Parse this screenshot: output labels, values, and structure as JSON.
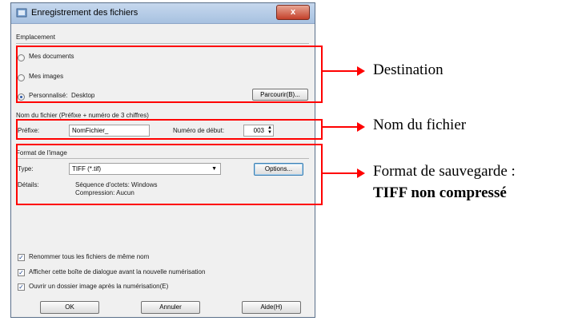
{
  "window": {
    "title": "Enregistrement des fichiers",
    "close_label": "x"
  },
  "emplacement": {
    "label": "Emplacement",
    "options": [
      {
        "label": "Mes documents",
        "checked": false
      },
      {
        "label": "Mes images",
        "checked": false
      },
      {
        "label": "Personnalisé:",
        "checked": true
      }
    ],
    "custom_value": "Desktop",
    "browse_label": "Parcourir(B)..."
  },
  "nom": {
    "label": "Nom du fichier (Préfixe + numéro de 3 chiffres)",
    "prefix_label": "Préfixe:",
    "prefix_value": "NomFichier_",
    "start_label": "Numéro de début:",
    "start_value": "003"
  },
  "format": {
    "label": "Format de l'image",
    "type_label": "Type:",
    "type_value": "TIFF (*.tif)",
    "options_label": "Options...",
    "details_label": "Détails:",
    "details_line1": "Séquence d'octets: Windows",
    "details_line2": "Compression: Aucun"
  },
  "checkboxes": [
    {
      "label": "Renommer tous les fichiers de même nom",
      "checked": true
    },
    {
      "label": "Afficher cette boîte de dialogue avant la nouvelle numérisation",
      "checked": true
    },
    {
      "label": "Ouvrir un dossier image après la numérisation(E)",
      "checked": true
    }
  ],
  "buttons": {
    "ok": "OK",
    "cancel": "Annuler",
    "help": "Aide(H)"
  },
  "annotations": {
    "destination": "Destination",
    "nom_fichier": "Nom du fichier",
    "format_line1": "Format de sauvegarde :",
    "format_line2": "TIFF non compressé"
  },
  "colors": {
    "highlight": "#ff0000"
  }
}
